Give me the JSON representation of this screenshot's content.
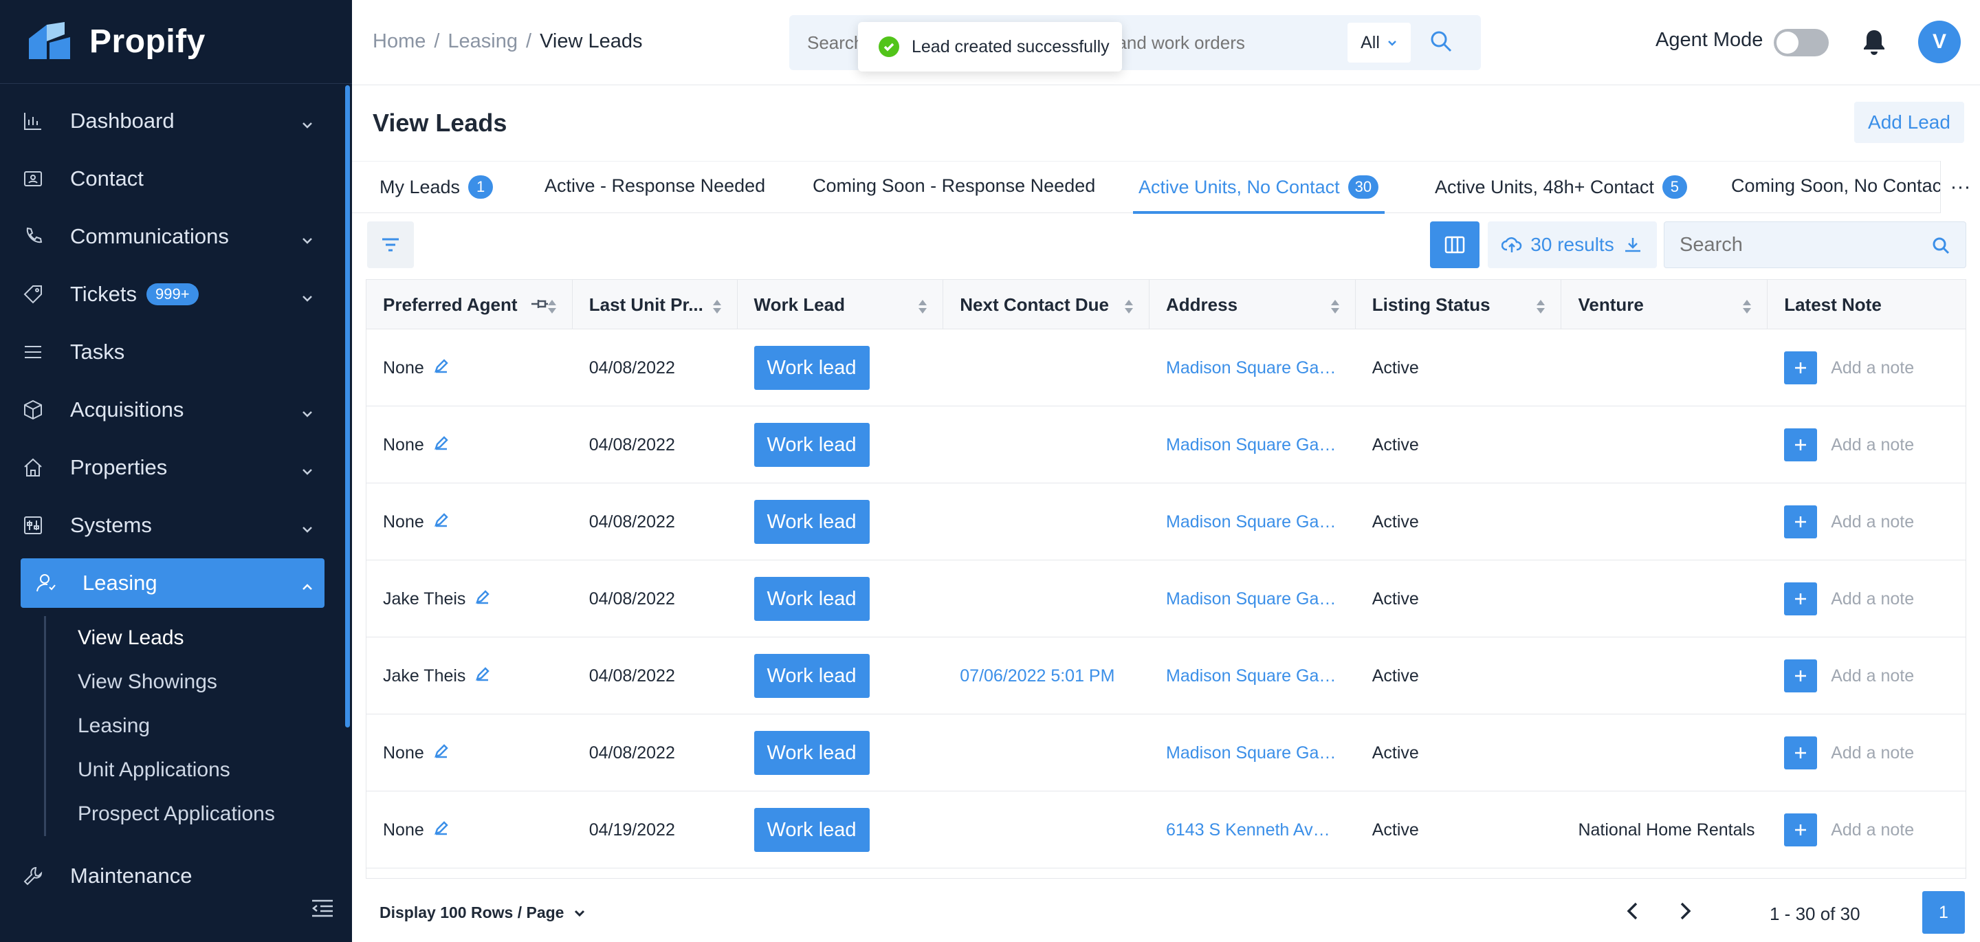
{
  "app": {
    "name": "Propify",
    "brand_color": "#3b8fe8",
    "sidebar_color": "#0f1d33"
  },
  "sidebar": {
    "items": [
      {
        "label": "Dashboard",
        "icon": "bar-chart-icon",
        "expandable": true
      },
      {
        "label": "Contact",
        "icon": "contact-card-icon",
        "expandable": false
      },
      {
        "label": "Communications",
        "icon": "phone-icon",
        "expandable": true
      },
      {
        "label": "Tickets",
        "icon": "ticket-icon",
        "expandable": true,
        "badge": "999+"
      },
      {
        "label": "Tasks",
        "icon": "list-icon",
        "expandable": false
      },
      {
        "label": "Acquisitions",
        "icon": "cube-icon",
        "expandable": true
      },
      {
        "label": "Properties",
        "icon": "home-icon",
        "expandable": true
      },
      {
        "label": "Systems",
        "icon": "sliders-icon",
        "expandable": true
      },
      {
        "label": "Leasing",
        "icon": "user-icon",
        "expandable": true,
        "active": true
      }
    ],
    "leasing_sub": [
      {
        "label": "View Leads",
        "current": true
      },
      {
        "label": "View Showings"
      },
      {
        "label": "Leasing"
      },
      {
        "label": "Unit Applications"
      },
      {
        "label": "Prospect Applications"
      }
    ],
    "maintenance": {
      "label": "Maintenance",
      "icon": "wrench-icon"
    }
  },
  "header": {
    "breadcrumb": [
      "Home",
      "/",
      "Leasing",
      "/",
      "View Leads"
    ],
    "search_placeholder": "Search by tenant, property, application and work orders",
    "search_scope": "All",
    "agent_mode_label": "Agent Mode",
    "agent_mode_on": false,
    "avatar_initial": "V"
  },
  "toast": {
    "message": "Lead created successfully",
    "type": "success"
  },
  "page": {
    "title": "View Leads",
    "add_button": "Add Lead"
  },
  "tabs": [
    {
      "label": "My Leads",
      "count": "1"
    },
    {
      "label": "Active - Response Needed"
    },
    {
      "label": "Coming Soon - Response Needed"
    },
    {
      "label": "Active Units, No Contact",
      "count": "30",
      "active": true
    },
    {
      "label": "Active Units, 48h+ Contact",
      "count": "5"
    },
    {
      "label": "Coming Soon, No Contact"
    }
  ],
  "tabs_more": "···",
  "toolbar": {
    "results_label": "30 results",
    "search_placeholder": "Search"
  },
  "table": {
    "columns": [
      "Preferred Agent",
      "Last Unit Pr...",
      "Work Lead",
      "Next Contact Due",
      "Address",
      "Listing Status",
      "Venture",
      "Latest Note"
    ],
    "work_button_label": "Work lead",
    "note_placeholder": "Add a note",
    "rows": [
      {
        "agent": "None",
        "last_unit": "04/08/2022",
        "next_contact": "",
        "address": "Madison Square Garden...",
        "status": "Active",
        "venture": ""
      },
      {
        "agent": "None",
        "last_unit": "04/08/2022",
        "next_contact": "",
        "address": "Madison Square Garden...",
        "status": "Active",
        "venture": ""
      },
      {
        "agent": "None",
        "last_unit": "04/08/2022",
        "next_contact": "",
        "address": "Madison Square Garden...",
        "status": "Active",
        "venture": ""
      },
      {
        "agent": "Jake Theis",
        "last_unit": "04/08/2022",
        "next_contact": "",
        "address": "Madison Square Garden...",
        "status": "Active",
        "venture": ""
      },
      {
        "agent": "Jake Theis",
        "last_unit": "04/08/2022",
        "next_contact": "07/06/2022 5:01 PM",
        "address": "Madison Square Garden...",
        "status": "Active",
        "venture": ""
      },
      {
        "agent": "None",
        "last_unit": "04/08/2022",
        "next_contact": "",
        "address": "Madison Square Garden...",
        "status": "Active",
        "venture": ""
      },
      {
        "agent": "None",
        "last_unit": "04/19/2022",
        "next_contact": "",
        "address": "6143 S Kenneth Ave, ...",
        "status": "Active",
        "venture": "National Home Rentals"
      }
    ]
  },
  "footer": {
    "rows_per_page": "Display 100 Rows / Page",
    "range": "1 - 30 of 30",
    "current_page": "1"
  }
}
